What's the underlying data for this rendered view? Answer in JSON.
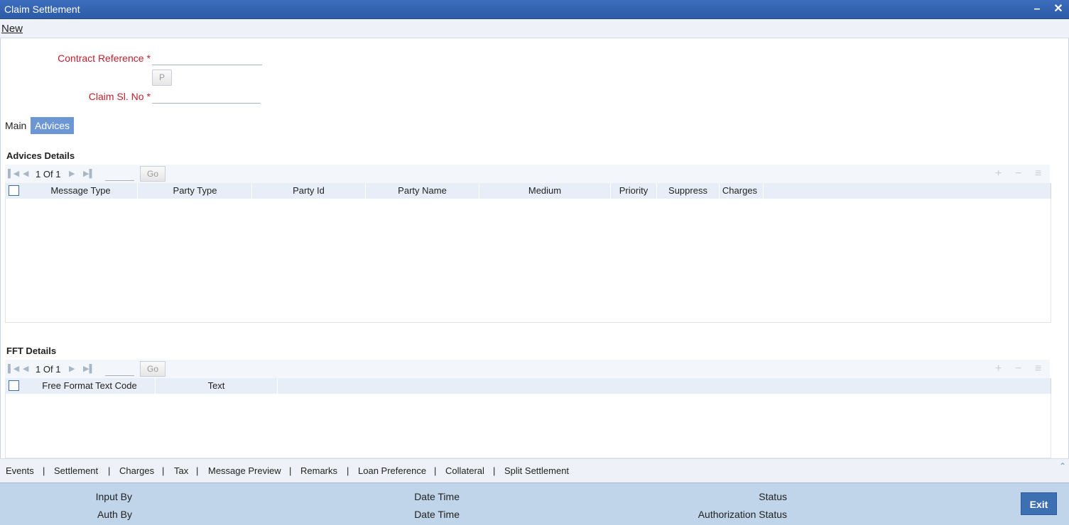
{
  "window": {
    "title": "Claim Settlement",
    "minimize_symbol": "–",
    "close_symbol": "✕"
  },
  "menu": {
    "new_label": "New"
  },
  "form": {
    "contract_reference_label": "Contract Reference",
    "required_marker": "*",
    "contract_reference_value": "",
    "p_button_label": "P",
    "claim_sl_no_label": "Claim Sl. No",
    "claim_sl_no_value": ""
  },
  "tabs": {
    "main": "Main",
    "advices": "Advices"
  },
  "advices": {
    "title": "Advices Details",
    "pager": {
      "current": "1",
      "of_label": "Of",
      "total": "1",
      "go_label": "Go"
    },
    "columns": [
      "Message Type",
      "Party Type",
      "Party Id",
      "Party Name",
      "Medium",
      "Priority",
      "Suppress",
      "Charges"
    ]
  },
  "fft": {
    "title": "FFT Details",
    "pager": {
      "current": "1",
      "of_label": "Of",
      "total": "1",
      "go_label": "Go"
    },
    "columns": [
      "Free Format Text Code",
      "Text"
    ]
  },
  "bottom_links": [
    "Events",
    "Settlement",
    "Charges",
    "Tax",
    "Message Preview",
    "Remarks",
    "Loan Preference",
    "Collateral",
    "Split Settlement"
  ],
  "footer": {
    "input_by": "Input By",
    "auth_by": "Auth By",
    "date_time_1": "Date Time",
    "date_time_2": "Date Time",
    "status": "Status",
    "authorization_status": "Authorization Status",
    "exit_label": "Exit"
  },
  "colors": {
    "titlebar": "#2c5aa6",
    "required": "#c2202d",
    "active_tab": "#6d97d4",
    "footer": "#c1d5ea",
    "exit_button": "#3d6fb3"
  },
  "icons": [
    "first-page-icon",
    "prev-page-icon",
    "next-page-icon",
    "last-page-icon",
    "add-row-icon",
    "delete-row-icon",
    "single-view-icon",
    "scroll-up-icon"
  ]
}
